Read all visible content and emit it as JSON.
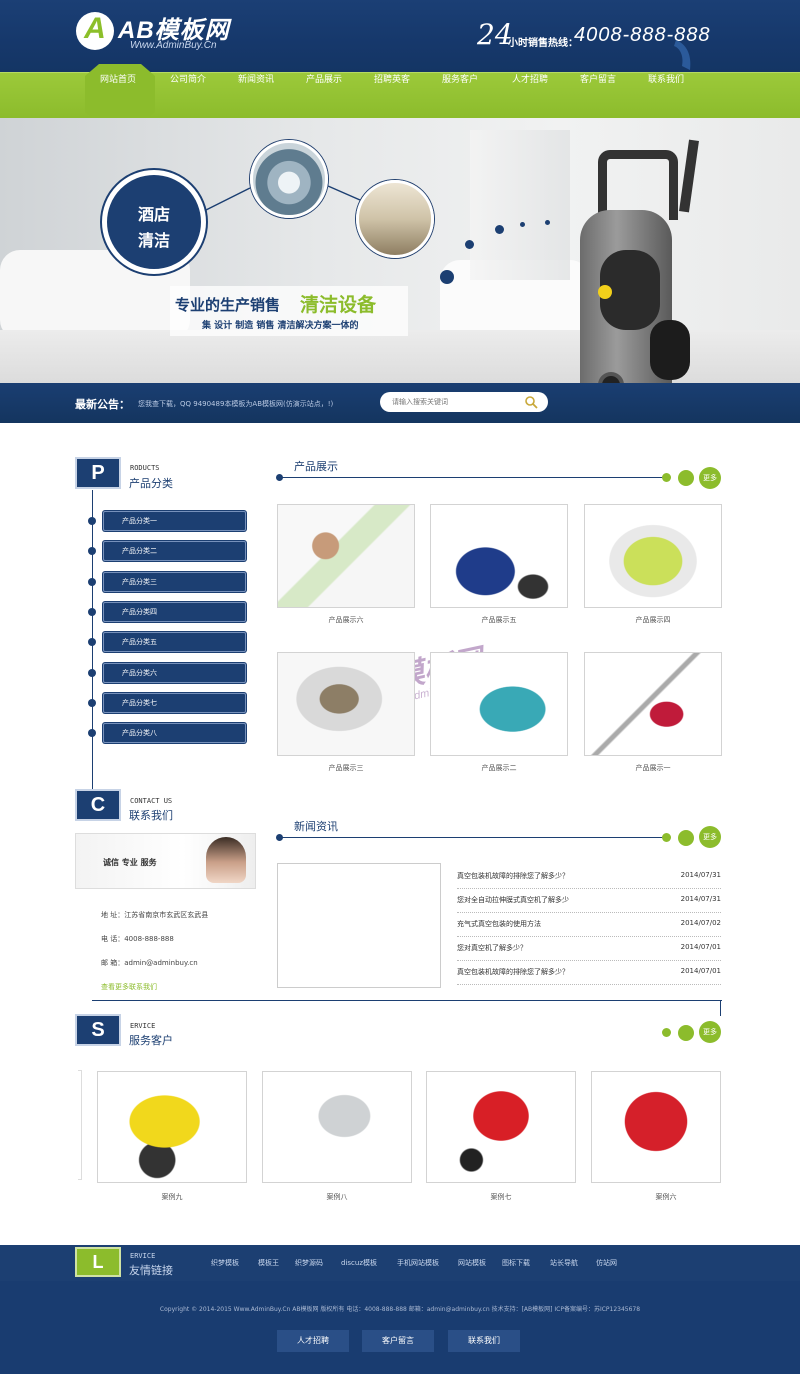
{
  "header": {
    "logo_mark": "A",
    "logo_text": "AB模板网",
    "logo_sub": "Www.AdminBuy.Cn",
    "hotline_num": "24",
    "hotline_label": "小时销售热线：",
    "hotline_phone": "4008-888-888"
  },
  "nav": {
    "items": [
      "网站首页",
      "公司简介",
      "新闻资讯",
      "产品展示",
      "招聘英客",
      "服务客户",
      "人才招聘",
      "客户留言",
      "联系我们"
    ]
  },
  "banner": {
    "circle_line1": "酒店",
    "circle_line2": "清洁",
    "slogan": "专业的生产销售",
    "slogan_highlight": "清洁设备",
    "sub": "集 设计  制造  销售  清洁解决方案一体的"
  },
  "notice": {
    "label": "最新公告：",
    "text": "您我查下载，QQ 9490489本模板为AB模板网(仿演示站点，!)",
    "search_placeholder": "请输入搜索关键词"
  },
  "sidebar": {
    "products": {
      "letter": "P",
      "en": "RODUCTS",
      "cn": "产品分类"
    },
    "categories": [
      "产品分类一",
      "产品分类二",
      "产品分类三",
      "产品分类四",
      "产品分类五",
      "产品分类六",
      "产品分类七",
      "产品分类八"
    ],
    "contact": {
      "letter": "C",
      "en": "CONTACT US",
      "cn": "联系我们",
      "img_text": "诚信  专业  服务"
    },
    "contact_info": [
      "地    址：江苏省南京市玄武区玄武县",
      "电    话：4008-888-888",
      "邮    箱：admin@adminbuy.cn"
    ],
    "contact_more": "查看更多联系我们"
  },
  "products": {
    "title": "产品展示",
    "more": "更多",
    "items": [
      "产品展示六",
      "产品展示五",
      "产品展示四",
      "产品展示三",
      "产品展示二",
      "产品展示一"
    ]
  },
  "news": {
    "title": "新闻资讯",
    "more": "更多",
    "items": [
      {
        "title": "真空包装机故障的排除您了解多少？",
        "date": "2014/07/31"
      },
      {
        "title": "您对全自动拉伸膜式真空机了解多少",
        "date": "2014/07/31"
      },
      {
        "title": "充气式真空包装的使用方法",
        "date": "2014/07/02"
      },
      {
        "title": "您对真空机了解多少？",
        "date": "2014/07/01"
      },
      {
        "title": "真空包装机故障的排除您了解多少？",
        "date": "2014/07/01"
      }
    ]
  },
  "service": {
    "letter": "S",
    "en": "ERVICE",
    "cn": "服务客户",
    "more": "更多",
    "items": [
      "案例九",
      "案例八",
      "案例七",
      "案例六"
    ]
  },
  "watermark": {
    "text": "AB模板网",
    "sub": "Www.AdminBuy.Cn"
  },
  "links": {
    "letter": "L",
    "en": "ERVICE",
    "cn": "友情链接",
    "items": [
      "织梦模板",
      "模板王",
      "织梦源码",
      "discuz模板",
      "手机网站模板",
      "网站模板",
      "图标下载",
      "站长导航",
      "仿站网"
    ]
  },
  "footer": {
    "copyright": "Copyright © 2014-2015 Www.AdminBuy.Cn  AB模板网 版权所有  电话：4008-888-888  邮箱：admin@adminbuy.cn  技术支持：[AB模板网]  ICP备案编号：苏ICP12345678",
    "buttons": [
      "人才招聘",
      "客户留言",
      "联系我们"
    ]
  },
  "colors": {
    "navy": "#1c3f72",
    "green": "#8cbc2c"
  }
}
